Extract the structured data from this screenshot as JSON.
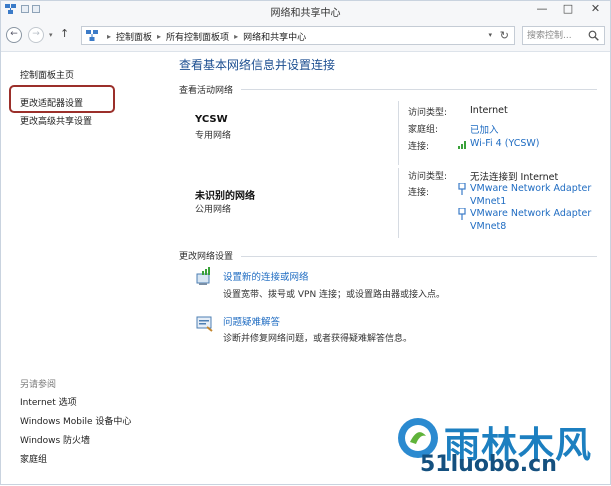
{
  "window": {
    "title": "网络和共享中心",
    "controls": {
      "minimize": "—",
      "maximize": "□",
      "close": "✕"
    }
  },
  "address": {
    "crumbs": [
      "控制面板",
      "所有控制面板项",
      "网络和共享中心"
    ],
    "search_placeholder": "搜索控制..."
  },
  "sidebar": {
    "items": [
      "控制面板主页",
      "更改适配器设置",
      "更改高级共享设置"
    ],
    "see_also_title": "另请参阅",
    "see_also": [
      "Internet 选项",
      "Windows Mobile 设备中心",
      "Windows 防火墙",
      "家庭组"
    ]
  },
  "main": {
    "title": "查看基本网络信息并设置连接",
    "active_networks_label": "查看活动网络",
    "networks": [
      {
        "name": "YCSW",
        "type": "专用网络",
        "access_label": "访问类型:",
        "access_value": "Internet",
        "homegroup_label": "家庭组:",
        "homegroup_value": "已加入",
        "conn_label": "连接:",
        "conn_value": "Wi-Fi 4 (YCSW)"
      },
      {
        "name": "未识别的网络",
        "type": "公用网络",
        "access_label": "访问类型:",
        "access_value": "无法连接到 Internet",
        "conn_label": "连接:",
        "conn_values": [
          "VMware Network Adapter VMnet1",
          "VMware Network Adapter VMnet8"
        ],
        "conn_lines": [
          "VMware Network Adapter",
          "VMnet1",
          "VMware Network Adapter",
          "VMnet8"
        ]
      }
    ],
    "change_settings_label": "更改网络设置",
    "tasks": [
      {
        "title": "设置新的连接或网络",
        "desc": "设置宽带、拨号或 VPN 连接；或设置路由器或接入点。"
      },
      {
        "title": "问题疑难解答",
        "desc": "诊断并修复网络问题，或者获得疑难解答信息。"
      }
    ]
  },
  "watermark": {
    "title": "雨林木风",
    "url": "51luobo.cn"
  },
  "colors": {
    "link": "#1f6cc2",
    "title": "#1d4f91",
    "highlight": "#9b2f2a"
  }
}
